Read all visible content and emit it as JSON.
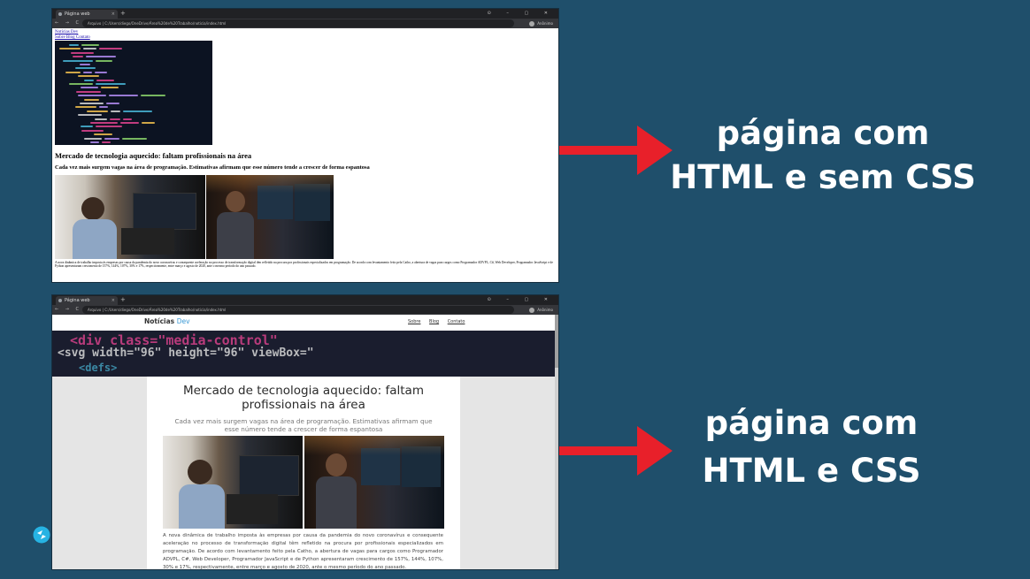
{
  "browser": {
    "tab_title": "Página web",
    "tab_close": "×",
    "new_tab": "+",
    "window_controls": "⊙ – ▢ ✕",
    "nav": "← → C",
    "url": "Arquivo  |  C:/Users/diego/OneDrive/Área%20de%20Trabalho/noticia/index.html",
    "profile_name": "Anônimo"
  },
  "top_page": {
    "links": [
      "Notícias Dev",
      "Sobre Blog Contato"
    ],
    "title": "Mercado de tecnologia aquecido: faltam profissionais na área",
    "subtitle": "Cada vez mais surgem vagas na área de programação. Estimativas afirmam que esse número tende a crescer de forma espantosa",
    "paragraph": "A nova dinâmica de trabalho imposta às empresas por causa da pandemia do novo coronavírus e consequente aceleração no processo de transformação digital têm refletido na procura por profissionais especializados em programação. De acordo com levantamento feito pela Catho, a abertura de vagas para cargos como Programador ADVPL, C#, Web Developer, Programador JavaScript e de Python apresentaram crescimento de 157%, 144%, 107%, 30% e 17%, respectivamente, entre março e agosto de 2020, ante o mesmo período do ano passado."
  },
  "styled_page": {
    "logo_main": "Notícias",
    "logo_accent": "Dev",
    "menu": [
      "Sobre",
      "Blog",
      "Contato"
    ],
    "banner_line1": "<div class=\"media-control\"",
    "banner_line2": "<svg width=\"96\" height=\"96\" viewBox=\"",
    "banner_line3": "<defs>",
    "title": "Mercado de tecnologia aquecido: faltam profissionais na área",
    "subtitle": "Cada vez mais surgem vagas na área de programação. Estimativas afirmam que esse número tende a crescer de forma espantosa",
    "paragraph": "A nova dinâmica de trabalho imposta às empresas por causa da pandemia do novo coronavírus e consequente aceleração no processo de transformação digital têm refletido na procura por profissionais especializados em programação. De acordo com levantamento feito pela Catho, a abertura de vagas para cargos como Programador ADVPL, C#, Web Developer, Programador JavaScript e de Python apresentaram crescimento de 157%, 144%, 107%, 30% e 17%, respectivamente, entre março e agosto de 2020, ante o mesmo período do ano passado."
  },
  "labels": {
    "top_line1": "página com",
    "top_line2": "HTML e sem CSS",
    "bottom_line1": "página com",
    "bottom_line2": "HTML e CSS"
  },
  "colors": {
    "background": "#1f4f6b",
    "arrow": "#e8202a",
    "label": "#ffffff",
    "accent": "#3c9ad6"
  }
}
